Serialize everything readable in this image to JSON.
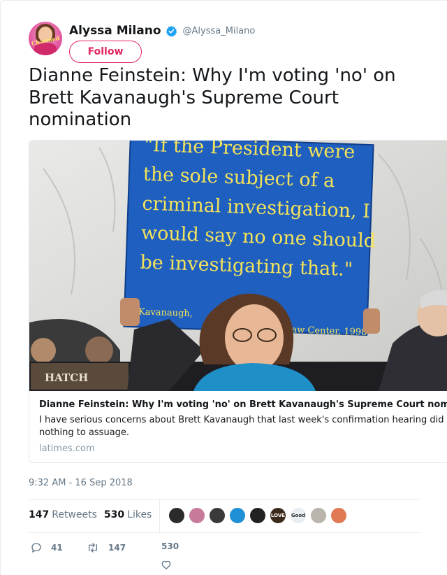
{
  "author": {
    "display_name": "Alyssa Milano",
    "handle": "@Alyssa_Milano",
    "avatar_icon": "profile-photo-avatar",
    "avatar_text": "Charmed",
    "verified_icon": "verified-badge-icon",
    "verified_color": "#1da1f2"
  },
  "follow_button": {
    "label": "Follow",
    "color": "#e0245e"
  },
  "tweet": {
    "text": "Dianne Feinstein: Why I'm voting 'no' on Brett Kavanaugh's Supreme Court nomination"
  },
  "card": {
    "photo": {
      "sign_lines": [
        "\"If the President were",
        "the sole subject of a",
        "criminal investigation, I",
        "would say no one should",
        "be investigating that.\""
      ],
      "sign_attribution_left": "Kavanaugh,",
      "sign_attribution_right": "y Law Center, 1998",
      "nameplate": "HATCH"
    },
    "title": "Dianne Feinstein: Why I'm voting 'no' on Brett Kavanaugh's Supreme Court nomination",
    "description": "I have serious concerns about Brett Kavanaugh that last week's confirmation hearing did nothing to assuage.",
    "domain": "latimes.com"
  },
  "timestamp": "9:32 AM - 16 Sep 2018",
  "stats": {
    "retweets_count": "147",
    "retweets_label": "Retweets",
    "likes_count": "530",
    "likes_label": "Likes"
  },
  "likers": [
    {
      "icon": "liker-avatar-1",
      "color": "#2b2b2b"
    },
    {
      "icon": "liker-avatar-2",
      "color": "#c77a9a"
    },
    {
      "icon": "liker-avatar-3",
      "color": "#3a3a3a"
    },
    {
      "icon": "liker-avatar-4",
      "color": "#1f8fd6"
    },
    {
      "icon": "liker-avatar-5",
      "color": "#222222"
    },
    {
      "icon": "liker-avatar-6",
      "color": "#3b2a1a",
      "text": "LOVE"
    },
    {
      "icon": "liker-avatar-7",
      "color": "#e8eef3",
      "text": "Good"
    },
    {
      "icon": "liker-avatar-8",
      "color": "#b9b5ad"
    },
    {
      "icon": "liker-avatar-9",
      "color": "#e07a54"
    }
  ],
  "actions": {
    "reply_count": "41",
    "retweet_count": "147",
    "like_count": "530"
  }
}
